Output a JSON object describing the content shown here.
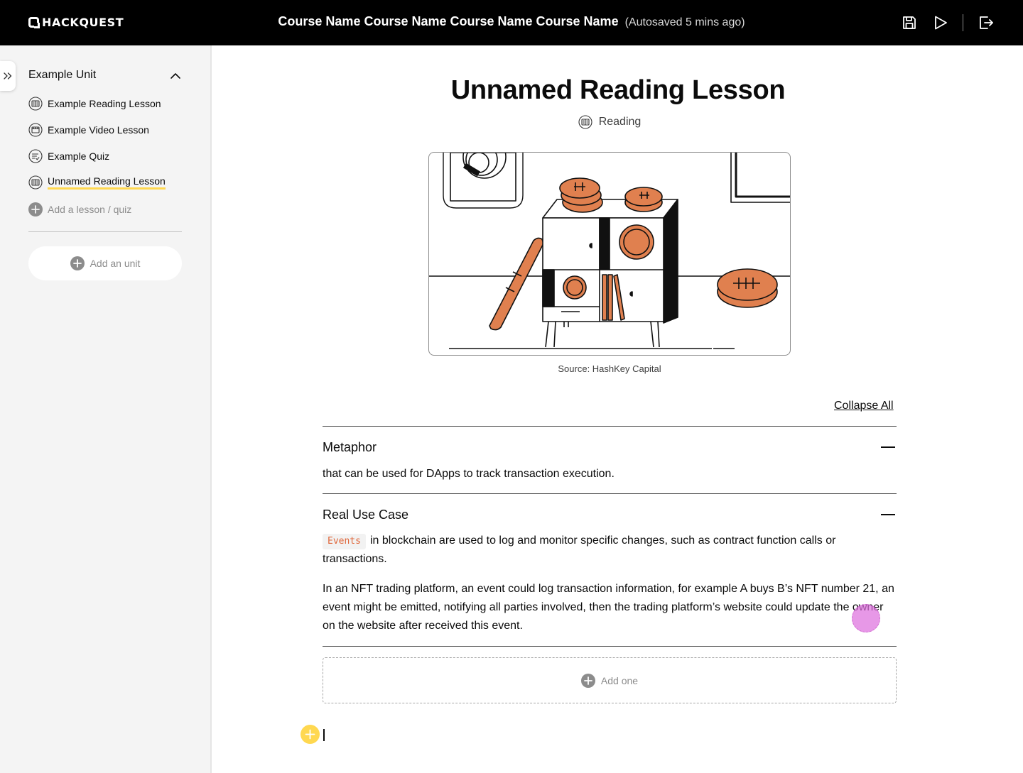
{
  "brand": {
    "logo_text": "HACKQUEST"
  },
  "header": {
    "course_name": "Course Name Course Name Course Name Course Name",
    "autosave_text": "(Autosaved 5 mins ago)",
    "icons": [
      "save-icon",
      "play-icon",
      "exit-icon"
    ]
  },
  "sidebar": {
    "unit_title": "Example Unit",
    "lessons": [
      {
        "label": "Example Reading Lesson",
        "icon": "reading-icon"
      },
      {
        "label": "Example Video Lesson",
        "icon": "video-icon"
      },
      {
        "label": "Example Quiz",
        "icon": "quiz-icon"
      },
      {
        "label": "Unnamed Reading Lesson",
        "icon": "reading-icon",
        "active": true
      }
    ],
    "add_lesson_label": "Add a lesson / quiz",
    "add_unit_label": "Add an unit"
  },
  "main": {
    "title": "Unnamed Reading Lesson",
    "type_label": "Reading",
    "image_caption": "Source: HashKey Capital",
    "collapse_all_label": "Collapse All",
    "sections": [
      {
        "title": "Metaphor",
        "paragraphs": [
          "that can be used for DApps to track transaction execution."
        ]
      },
      {
        "title": "Real Use Case",
        "code_chip": "Events",
        "paragraphs": [
          "in blockchain are used to log and monitor specific changes, such as contract function calls or transactions.",
          "In an NFT trading platform, an event could log transaction information, for example A buys B’s NFT number 21, an event might be emitted, notifying all parties involved, then the trading platform’s website could update the owner on the website after received this event."
        ]
      }
    ],
    "add_one_label": "Add one"
  },
  "colors": {
    "accent_yellow": "#ffd850",
    "coin_orange": "#e0804f",
    "code_orange": "#e0673b",
    "topbar_bg": "#000000",
    "sidebar_bg": "#f4f4f4"
  }
}
